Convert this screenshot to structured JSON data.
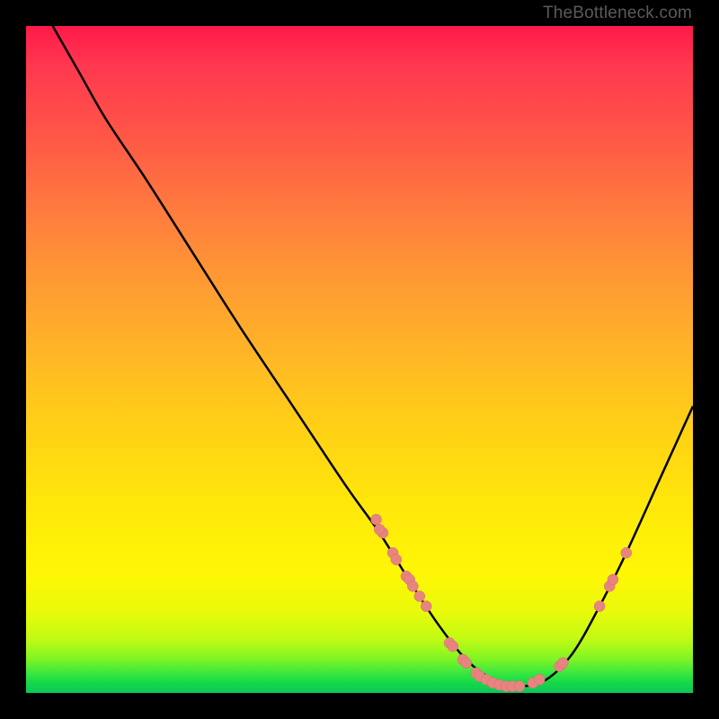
{
  "watermark": "TheBottleneck.com",
  "chart_data": {
    "type": "line",
    "title": "",
    "xlabel": "",
    "ylabel": "",
    "xlim": [
      0,
      100
    ],
    "ylim": [
      0,
      100
    ],
    "curve": [
      {
        "x": 4,
        "y": 100
      },
      {
        "x": 8,
        "y": 93
      },
      {
        "x": 12,
        "y": 86
      },
      {
        "x": 18,
        "y": 77
      },
      {
        "x": 25,
        "y": 66
      },
      {
        "x": 32,
        "y": 55
      },
      {
        "x": 40,
        "y": 43
      },
      {
        "x": 48,
        "y": 31
      },
      {
        "x": 53,
        "y": 24
      },
      {
        "x": 58,
        "y": 16
      },
      {
        "x": 62,
        "y": 10
      },
      {
        "x": 66,
        "y": 5
      },
      {
        "x": 70,
        "y": 2
      },
      {
        "x": 74,
        "y": 1
      },
      {
        "x": 78,
        "y": 2
      },
      {
        "x": 82,
        "y": 6
      },
      {
        "x": 86,
        "y": 13
      },
      {
        "x": 90,
        "y": 21
      },
      {
        "x": 95,
        "y": 32
      },
      {
        "x": 100,
        "y": 43
      }
    ],
    "markers": [
      {
        "x": 52.5,
        "y": 26
      },
      {
        "x": 53.5,
        "y": 24
      },
      {
        "x": 53,
        "y": 24.5
      },
      {
        "x": 55,
        "y": 21
      },
      {
        "x": 55.5,
        "y": 20
      },
      {
        "x": 57,
        "y": 17.5
      },
      {
        "x": 57.5,
        "y": 17
      },
      {
        "x": 58,
        "y": 16
      },
      {
        "x": 59,
        "y": 14.5
      },
      {
        "x": 60,
        "y": 13
      },
      {
        "x": 63.5,
        "y": 7.5
      },
      {
        "x": 64,
        "y": 7
      },
      {
        "x": 65.5,
        "y": 5
      },
      {
        "x": 66,
        "y": 4.5
      },
      {
        "x": 67.5,
        "y": 3
      },
      {
        "x": 68,
        "y": 2.5
      },
      {
        "x": 69,
        "y": 2
      },
      {
        "x": 70,
        "y": 1.5
      },
      {
        "x": 71,
        "y": 1.2
      },
      {
        "x": 72,
        "y": 1
      },
      {
        "x": 73,
        "y": 1
      },
      {
        "x": 74,
        "y": 1
      },
      {
        "x": 76,
        "y": 1.5
      },
      {
        "x": 77,
        "y": 2
      },
      {
        "x": 80,
        "y": 4
      },
      {
        "x": 80.5,
        "y": 4.5
      },
      {
        "x": 86,
        "y": 13
      },
      {
        "x": 87.5,
        "y": 16
      },
      {
        "x": 88,
        "y": 17
      },
      {
        "x": 90,
        "y": 21
      }
    ]
  }
}
